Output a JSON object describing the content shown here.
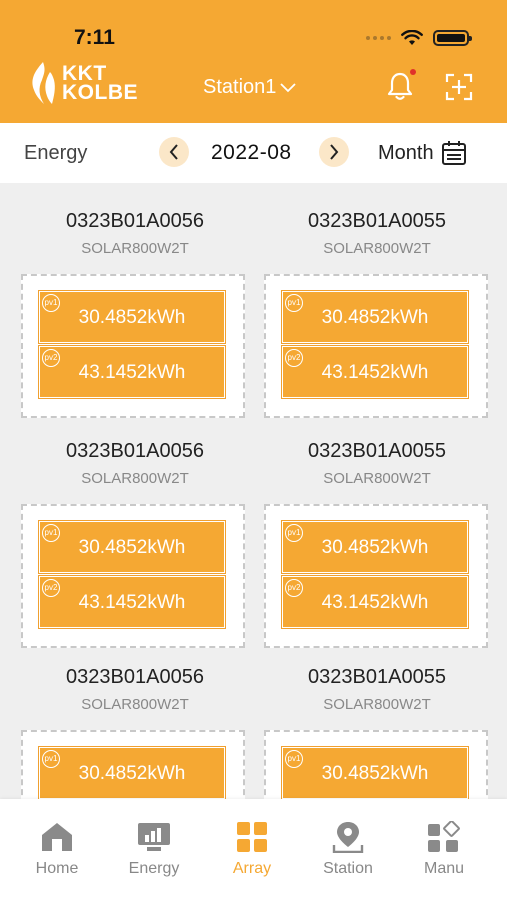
{
  "status_bar": {
    "time": "7:11"
  },
  "header": {
    "logo_line1": "KKT",
    "logo_line2": "KOLBE",
    "station": "Station1",
    "accent": "#f5a833",
    "notification_dot": "#e0322a"
  },
  "date_bar": {
    "label": "Energy",
    "date": "2022-08",
    "period": "Month",
    "prev_icon": "chevron-left-icon",
    "next_icon": "chevron-right-icon",
    "calendar_icon": "calendar-icon"
  },
  "devices": [
    {
      "id": "0323B01A0056",
      "model": "SOLAR800W2T",
      "pv1_badge": "pv1",
      "pv1": "30.4852kWh",
      "pv2_badge": "pv2",
      "pv2": "43.1452kWh"
    },
    {
      "id": "0323B01A0055",
      "model": "SOLAR800W2T",
      "pv1_badge": "pv1",
      "pv1": "30.4852kWh",
      "pv2_badge": "pv2",
      "pv2": "43.1452kWh"
    },
    {
      "id": "0323B01A0056",
      "model": "SOLAR800W2T",
      "pv1_badge": "pv1",
      "pv1": "30.4852kWh",
      "pv2_badge": "pv2",
      "pv2": "43.1452kWh"
    },
    {
      "id": "0323B01A0055",
      "model": "SOLAR800W2T",
      "pv1_badge": "pv1",
      "pv1": "30.4852kWh",
      "pv2_badge": "pv2",
      "pv2": "43.1452kWh"
    },
    {
      "id": "0323B01A0056",
      "model": "SOLAR800W2T",
      "pv1_badge": "pv1",
      "pv1": "30.4852kWh"
    },
    {
      "id": "0323B01A0055",
      "model": "SOLAR800W2T",
      "pv1_badge": "pv1",
      "pv1": "30.4852kWh"
    }
  ],
  "tabs": [
    {
      "label": "Home",
      "icon": "home-icon"
    },
    {
      "label": "Energy",
      "icon": "energy-monitor-icon"
    },
    {
      "label": "Array",
      "icon": "array-grid-icon",
      "active": true
    },
    {
      "label": "Station",
      "icon": "station-pin-icon"
    },
    {
      "label": "Manu",
      "icon": "menu-grid-icon"
    }
  ]
}
